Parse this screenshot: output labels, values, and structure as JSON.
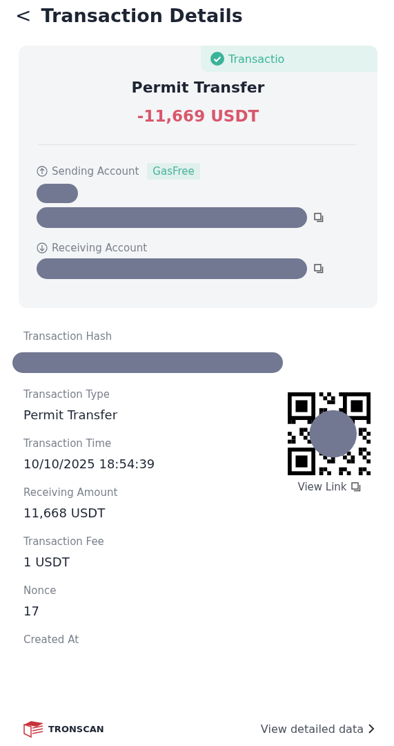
{
  "header": {
    "back": "<",
    "title": "Transaction Details"
  },
  "summary": {
    "status": {
      "label": "Transactio",
      "success": true
    },
    "type": "Permit Transfer",
    "amount": "-11,669 USDT",
    "accounts": [
      {
        "kind": "send",
        "label": "Sending Account",
        "tag": "GasFree",
        "name_redacted": true
      },
      {
        "kind": "receive",
        "label": "Receiving Account"
      }
    ]
  },
  "hash": {
    "label": "Transaction Hash"
  },
  "fields": [
    {
      "label": "Transaction Type",
      "value": "Permit Transfer"
    },
    {
      "label": "Transaction Time",
      "value": "10/10/2025 18:54:39"
    },
    {
      "label": "Receiving Amount",
      "value": "11,668 USDT"
    },
    {
      "label": "Transaction Fee",
      "value": "1 USDT"
    },
    {
      "label": "Nonce",
      "value": "17"
    },
    {
      "label": "Created At"
    }
  ],
  "qr": {
    "link": "View Link"
  },
  "footer": {
    "brand": "TRONSCAN",
    "action": "View detailed data"
  }
}
